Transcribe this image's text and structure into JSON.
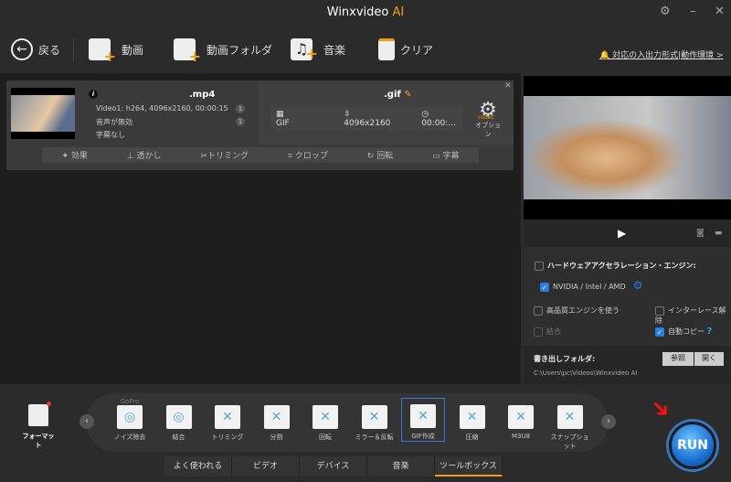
{
  "window": {
    "title": "Winxvideo",
    "title_accent": "AI",
    "accent_color": "#f39c12"
  },
  "toolbar": {
    "back": "戻る",
    "video": "動画",
    "video_folder": "動画フォルダ",
    "music": "音楽",
    "clear": "クリア",
    "support_link": "対応の入出力形式|動作環境 >"
  },
  "task": {
    "input_ext": ".mp4",
    "video_info": "Video1: h264, 4096x2160, 00:00:15",
    "audio_info": "音声が無効",
    "subtitle_info": "字幕なし",
    "video_count": "1",
    "audio_count": "1",
    "output_ext": ".gif",
    "out_format": "GIF",
    "out_resolution": "4096x2160",
    "out_duration": "00:00:...",
    "codec_label": "codec",
    "option_label": "オプション",
    "edit_tools": [
      "効果",
      "透かし",
      "トリミング",
      "クロップ",
      "回転",
      "字幕"
    ]
  },
  "settings": {
    "hw_accel": {
      "label": "ハードウェアアクセラレーション・エンジン:",
      "checked": false
    },
    "gpu": {
      "label": "NVIDIA / Intel / AMD",
      "checked": true
    },
    "high_quality": {
      "label": "高品質エンジンを使う",
      "checked": false
    },
    "deinterlace": {
      "label": "インターレース解除",
      "checked": false
    },
    "merge": {
      "label": "結合",
      "checked": false,
      "disabled": true
    },
    "auto_copy": {
      "label": "自動コピー",
      "checked": true,
      "help": "?"
    },
    "output_folder_label": "書き出しフォルダ:",
    "browse": "参照",
    "open": "開く",
    "output_path": "C:\\Users\\pc\\Videos\\Winxvideo AI"
  },
  "format_label": "フォーマット",
  "tools": [
    {
      "label": "ノイズ除去",
      "badge": "GoPro"
    },
    {
      "label": "結合"
    },
    {
      "label": "トリミング"
    },
    {
      "label": "分割"
    },
    {
      "label": "回転"
    },
    {
      "label": "ミラー＆反転"
    },
    {
      "label": "GIF作成",
      "selected": true
    },
    {
      "label": "圧縮"
    },
    {
      "label": "M3U8"
    },
    {
      "label": "スナップショット"
    }
  ],
  "tabs": [
    {
      "label": "よく使われる"
    },
    {
      "label": "ビデオ"
    },
    {
      "label": "デバイス"
    },
    {
      "label": "音楽"
    },
    {
      "label": "ツールボックス",
      "active": true
    }
  ],
  "run_label": "RUN"
}
